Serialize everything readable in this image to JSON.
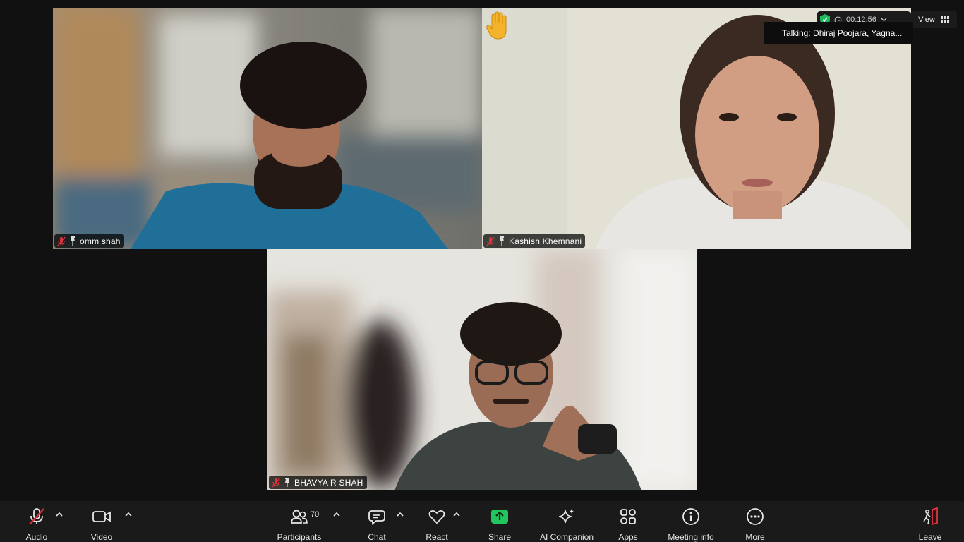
{
  "participants_tiles": [
    {
      "name": "omm shah"
    },
    {
      "name": "Kashish Khemnani"
    },
    {
      "name": "BHAVYA R SHAH"
    }
  ],
  "meeting": {
    "timer": "00:12:56",
    "view_label": "View",
    "talking": "Talking: Dhiraj Poojara, Yagna..."
  },
  "toolbar": {
    "audio": "Audio",
    "video": "Video",
    "participants": "Participants",
    "participants_count": "70",
    "chat": "Chat",
    "react": "React",
    "share": "Share",
    "ai_companion": "AI Companion",
    "apps": "Apps",
    "meeting_info": "Meeting info",
    "more": "More",
    "leave": "Leave"
  },
  "icons": {
    "audio": "microphone-muted-icon",
    "video": "camera-icon",
    "participants": "people-icon",
    "chat": "chat-bubble-icon",
    "react": "heart-icon",
    "share": "share-upload-icon",
    "ai_companion": "sparkle-icon",
    "apps": "apps-icon",
    "meeting_info": "info-icon",
    "more": "more-dots-icon",
    "leave": "exit-door-icon"
  },
  "colors": {
    "share_green": "#22c55e",
    "mute_red": "#e0323e",
    "shield_green": "#1fb85a",
    "leave_red": "#e0323e"
  }
}
